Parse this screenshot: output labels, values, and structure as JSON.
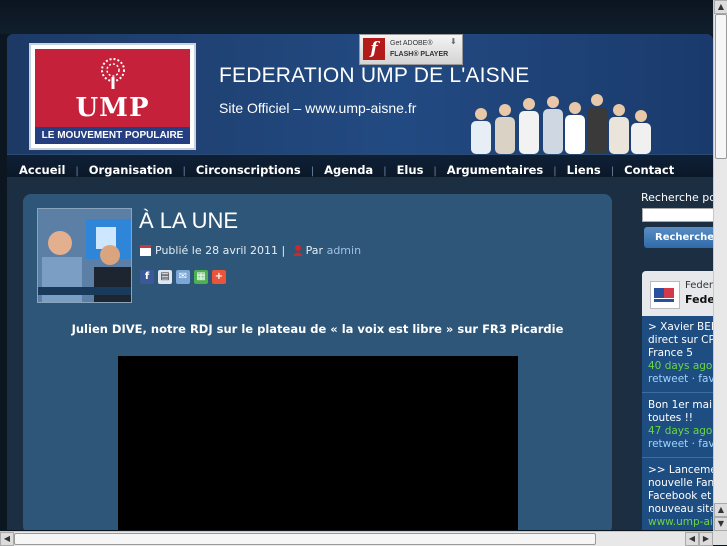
{
  "header": {
    "logo": {
      "text": "UMP",
      "tagline": "LE MOUVEMENT POPULAIRE"
    },
    "flash_banner": {
      "line1": "Get ADOBE®",
      "line2": "FLASH® PLAYER"
    },
    "site_title": "FEDERATION UMP DE L'AISNE",
    "site_subtitle": "Site Officiel – www.ump-aisne.fr"
  },
  "nav": {
    "items": [
      "Accueil",
      "Organisation",
      "Circonscriptions",
      "Agenda",
      "Elus",
      "Argumentaires",
      "Liens",
      "Contact"
    ]
  },
  "post": {
    "title": "À LA UNE",
    "published": "Publié le 28 avril 2011 |",
    "by": "Par",
    "author": "admin",
    "headline": "Julien DIVE, notre RDJ sur le plateau de « la voix est libre » sur FR3 Picardie"
  },
  "sidebar": {
    "search_label": "Recherche po",
    "search_placeholder": "",
    "search_button": "Recherche",
    "twitter": {
      "name_line1": "Feder",
      "name_line2": "Fede",
      "tweets": [
        {
          "lines": [
            "> Xavier BER",
            "direct sur CP",
            "France 5"
          ],
          "ago": "40 days ago",
          "actions": "retweet · fav"
        },
        {
          "lines": [
            "Bon 1er mai",
            "toutes !!"
          ],
          "ago": "47 days ago",
          "actions": "retweet · fav"
        },
        {
          "lines": [
            ">> Lanceme",
            "nouvelle Fan",
            "Facebook et",
            "nouveau site"
          ],
          "ago": "www.ump-ai",
          "actions": ""
        }
      ]
    }
  },
  "colors": {
    "header_blue": "#224a82",
    "content_bg": "#2e5678",
    "accent_green": "#6bd645",
    "ump_red": "#c5213a"
  }
}
